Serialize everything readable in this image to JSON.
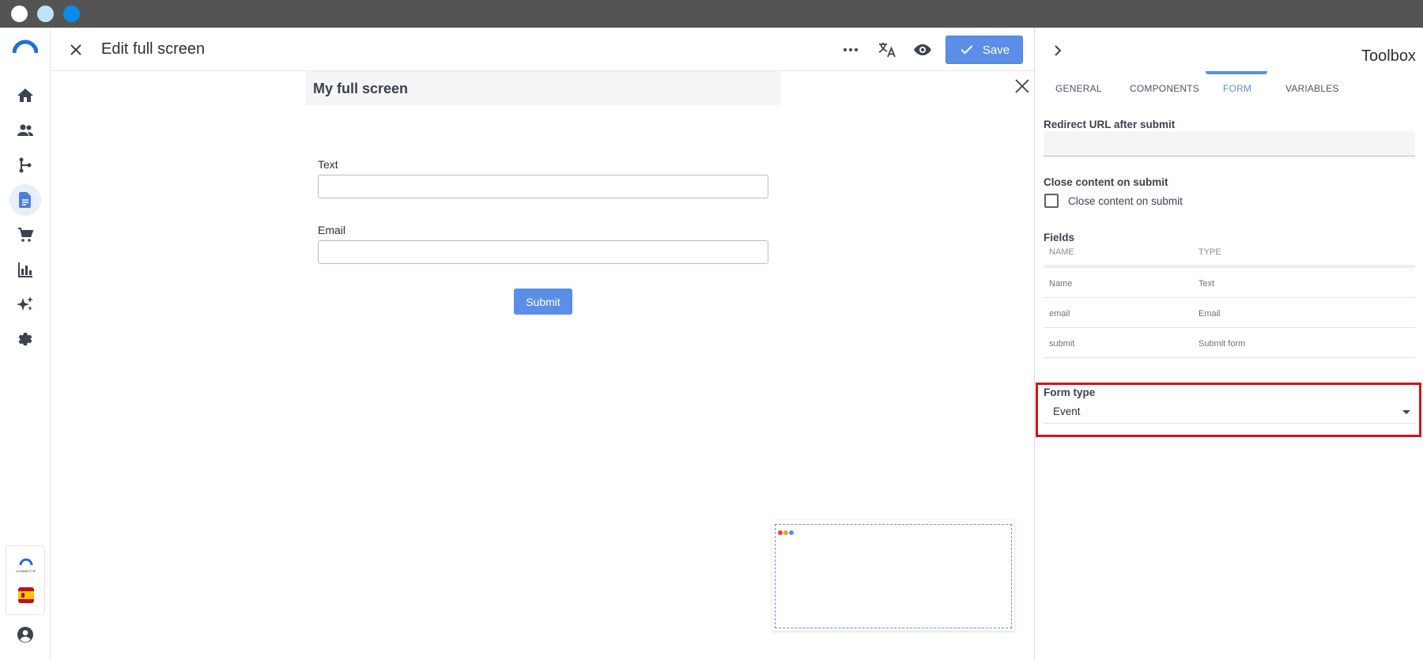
{
  "chrome": {
    "dots": [
      {
        "name": "close",
        "color": "#ffffff"
      },
      {
        "name": "minimize",
        "color": "#bfe3f8"
      },
      {
        "name": "maximize",
        "color": "#0a8de8"
      }
    ]
  },
  "nav": {
    "items": [
      {
        "name": "home-icon",
        "active": false
      },
      {
        "name": "users-icon",
        "active": false
      },
      {
        "name": "flow-icon",
        "active": false
      },
      {
        "name": "content-icon",
        "active": true
      },
      {
        "name": "cart-icon",
        "active": false
      },
      {
        "name": "analytics-icon",
        "active": false
      },
      {
        "name": "sparkle-icon",
        "active": false
      },
      {
        "name": "settings-icon",
        "active": false
      }
    ],
    "brand_small": "CONNECTIF",
    "flag": "spain-flag-icon"
  },
  "header": {
    "title": "Edit full screen",
    "save_label": "Save"
  },
  "canvas": {
    "screen_title": "My full screen",
    "fields": [
      {
        "label": "Text",
        "value": ""
      },
      {
        "label": "Email",
        "value": ""
      }
    ],
    "submit_label": "Submit"
  },
  "toolbox": {
    "title": "Toolbox",
    "tabs": [
      {
        "label": "GENERAL",
        "active": false
      },
      {
        "label": "COMPONENTS",
        "active": false
      },
      {
        "label": "FORM",
        "active": true
      },
      {
        "label": "VARIABLES",
        "active": false
      }
    ],
    "redirect_label": "Redirect URL after submit",
    "redirect_value": "",
    "close_section_label": "Close content on submit",
    "close_checkbox_label": "Close content on submit",
    "close_checked": false,
    "fields_label": "Fields",
    "fields_table": {
      "columns": [
        "NAME",
        "TYPE"
      ],
      "rows": [
        [
          "Name",
          "Text"
        ],
        [
          "email",
          "Email"
        ],
        [
          "submit",
          "Submit form"
        ]
      ]
    },
    "form_type_label": "Form type",
    "form_type_value": "Event"
  },
  "colors": {
    "accent": "#5b8ee6",
    "highlight": "#d0141b"
  }
}
